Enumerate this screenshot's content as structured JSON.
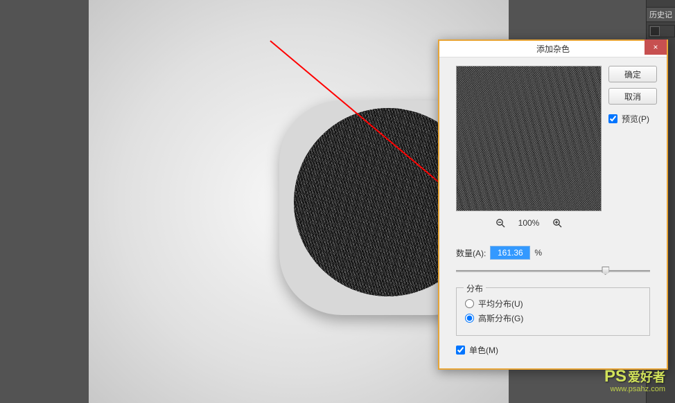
{
  "sidepanel": {
    "history_tab": "历史记"
  },
  "dialog": {
    "title": "添加杂色",
    "close_aria": "×",
    "ok_label": "确定",
    "cancel_label": "取消",
    "preview_label": "预览(P)",
    "preview_checked": true,
    "zoom": {
      "out": "−",
      "percent": "100%",
      "in_icon": "zoom-in"
    },
    "amount_label": "数量(A):",
    "amount_value": "161.36",
    "amount_unit": "%",
    "distribution": {
      "legend": "分布",
      "uniform_label": "平均分布(U)",
      "gaussian_label": "高斯分布(G)",
      "selected": "gaussian"
    },
    "monochrome_label": "单色(M)",
    "monochrome_checked": true
  },
  "watermark": {
    "ps": "PS",
    "cn": "爱好者",
    "url": "www.psahz.com"
  }
}
